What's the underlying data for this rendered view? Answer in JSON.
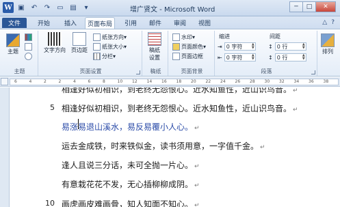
{
  "window": {
    "title": "增广贤文 - Microsoft Word",
    "qat_icons": [
      "word-icon",
      "save-icon",
      "undo-icon",
      "redo-icon",
      "new-doc-icon",
      "open-icon",
      "customize-icon"
    ],
    "minimize": "─",
    "maximize": "□",
    "close": "✕"
  },
  "tabs": [
    {
      "label": "文件"
    },
    {
      "label": "开始"
    },
    {
      "label": "插入"
    },
    {
      "label": "页面布局",
      "active": true
    },
    {
      "label": "引用"
    },
    {
      "label": "邮件"
    },
    {
      "label": "审阅"
    },
    {
      "label": "视图"
    }
  ],
  "ribbon": {
    "themes_group": {
      "label": "主题",
      "btn": "主题"
    },
    "page_setup": {
      "label": "页面设置",
      "text_direction": "文字方向",
      "margins": "页边距",
      "orientation": "纸张方向",
      "size": "纸张大小",
      "columns": "分栏"
    },
    "draft": {
      "label": "稿纸",
      "btn": "稿纸\n设置"
    },
    "page_bg": {
      "label": "页面背景",
      "watermark": "水印",
      "page_color": "页面颜色",
      "page_border": "页面边框"
    },
    "paragraph": {
      "label": "段落",
      "indent": "缩进",
      "spacing": "间距",
      "indent_left": "0 字符",
      "indent_right": "0 字符",
      "space_before": "0 行",
      "space_after": "0 行"
    },
    "arrange": {
      "btn": "排列"
    }
  },
  "ruler": {
    "numbers": [
      "6",
      "4",
      "2",
      "2",
      "4",
      "6",
      "8",
      "10",
      "12",
      "14",
      "16",
      "18",
      "20",
      "22",
      "24",
      "26",
      "28",
      "30",
      "32",
      "34",
      "36",
      "38"
    ]
  },
  "document": {
    "lines": [
      {
        "num": "",
        "text": "相逢好似初相识，到老终无怨恨心。近水知鱼性，近山识鸟音。",
        "blue": false
      },
      {
        "num": "5",
        "text": "相逢好似初相识，到老终无怨恨心。近水知鱼性，近山识鸟音。",
        "blue": false
      },
      {
        "num": "",
        "text": "易涨易退山溪水，易反易覆小人心。",
        "blue": true
      },
      {
        "num": "",
        "text": "运去金成铁，时来铁似金，读书须用意，一字值千金。",
        "blue": false
      },
      {
        "num": "",
        "text": "逢人且说三分话，未可全抛一片心。",
        "blue": false
      },
      {
        "num": "",
        "text": "有意栽花花不发，无心插柳柳成阴。",
        "blue": false
      },
      {
        "num": "10",
        "text": "画虎画皮难画骨，知人知面不知心。",
        "blue": false
      }
    ],
    "pilcrow": "↵"
  }
}
